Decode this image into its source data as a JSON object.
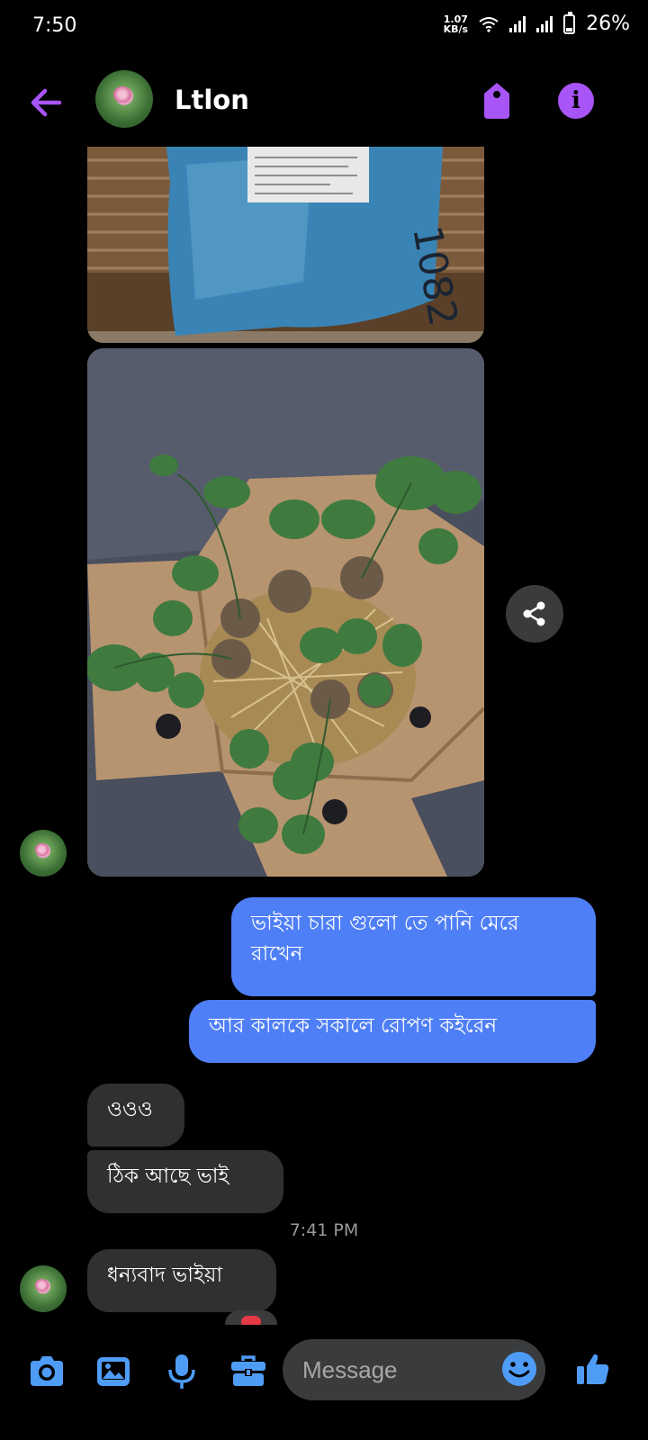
{
  "status_bar": {
    "time": "7:50",
    "net_speed_value": "1.07",
    "net_speed_unit": "KB/s",
    "battery": "26%"
  },
  "header": {
    "title": "Ltlon",
    "icons": {
      "back": "arrow-left-icon",
      "tag": "tag-icon",
      "info": "info-icon"
    },
    "accent": "#a855f7"
  },
  "media": [
    {
      "label": "package-photo",
      "handwriting": "1082"
    },
    {
      "label": "strawberry-seedlings-photo"
    }
  ],
  "messages": [
    {
      "side": "out",
      "text": "ভাইয়া চারা গুলো তে পানি মেরে রাখেন"
    },
    {
      "side": "out",
      "text": "আর কালকে সকালে রোপণ কইরেন"
    },
    {
      "side": "in",
      "text": "ওওও"
    },
    {
      "side": "in",
      "text": "ঠিক আছে ভাই"
    },
    {
      "side": "in",
      "text": "ধন্যবাদ ভাইয়া"
    }
  ],
  "timestamp": "7:41 PM",
  "composer": {
    "placeholder": "Message",
    "icons": [
      "camera-icon",
      "gallery-icon",
      "microphone-icon",
      "toolbox-icon",
      "emoji-icon",
      "thumbs-up-icon"
    ]
  },
  "colors": {
    "outgoing_bubble": "#4f7ff6",
    "incoming_bubble": "#303030",
    "icon_blue": "#4f9cf7"
  }
}
